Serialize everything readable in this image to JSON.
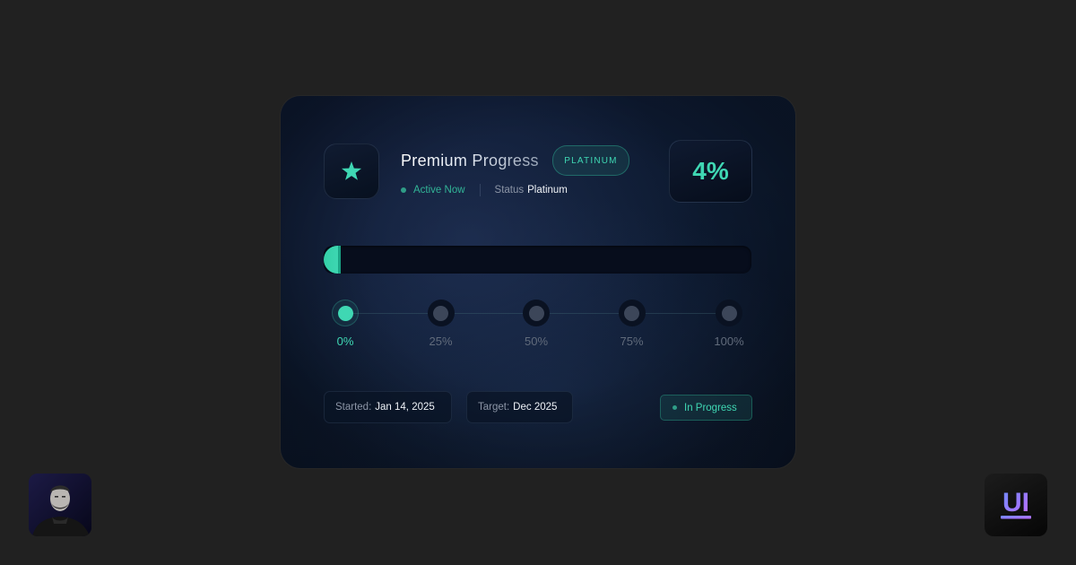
{
  "card": {
    "title": "Premium Progress",
    "tier_badge": "PLATINUM",
    "icon": "star-icon",
    "active_status": "Active Now",
    "status_label": "Status",
    "status_value": "Platinum",
    "percent_text": "4%",
    "progress_fraction": 0.04
  },
  "milestones": [
    {
      "label": "0%",
      "value": 0,
      "reached": true
    },
    {
      "label": "25%",
      "value": 25,
      "reached": false
    },
    {
      "label": "50%",
      "value": 50,
      "reached": false
    },
    {
      "label": "75%",
      "value": 75,
      "reached": false
    },
    {
      "label": "100%",
      "value": 100,
      "reached": false
    }
  ],
  "dates": {
    "started_label": "Started:",
    "started_value": "Jan 14, 2025",
    "target_label": "Target:",
    "target_value": "Dec 2025"
  },
  "state_badge": "In Progress",
  "corner": {
    "avatar": "author-avatar",
    "logo_text": "UI"
  },
  "colors": {
    "page_background": "#212121",
    "card_background": "#0d1a30",
    "accent": "#3fd7b3",
    "muted_text": "#8c95a6",
    "inactive_dot": "#3c4659",
    "logo_gradient_start": "#6d8cff",
    "logo_gradient_end": "#c06bff"
  }
}
